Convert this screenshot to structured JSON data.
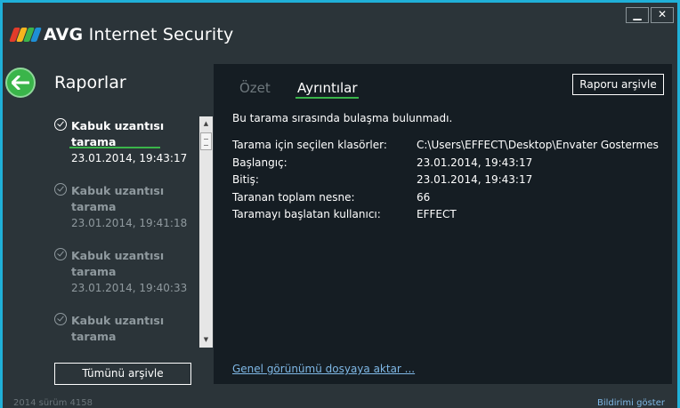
{
  "app": {
    "brand_bold": "AVG",
    "brand_rest": " Internet Security",
    "window_min": "▁",
    "window_close": "✕"
  },
  "sidebar": {
    "title": "Raporlar",
    "reports": [
      {
        "name": "Kabuk uzantısı tarama",
        "date": "23.01.2014, 19:43:17",
        "active": true
      },
      {
        "name": "Kabuk uzantısı tarama",
        "date": "23.01.2014, 19:41:18",
        "active": false
      },
      {
        "name": "Kabuk uzantısı tarama",
        "date": "23.01.2014, 19:40:33",
        "active": false
      },
      {
        "name": "Kabuk uzantısı tarama",
        "date": "",
        "active": false
      }
    ],
    "archive_all_label": "Tümünü arşivle"
  },
  "main": {
    "tabs": [
      {
        "label": "Özet",
        "selected": false
      },
      {
        "label": "Ayrıntılar",
        "selected": true
      }
    ],
    "archive_report_label": "Raporu arşivle",
    "message": "Bu tarama sırasında bulaşma bulunmadı.",
    "details": [
      {
        "key": "Tarama için seçilen klasörler:",
        "value": "C:\\Users\\EFFECT\\Desktop\\Envater Gostermes"
      },
      {
        "key": "Başlangıç:",
        "value": "23.01.2014, 19:43:17"
      },
      {
        "key": "Bitiş:",
        "value": "23.01.2014, 19:43:17"
      },
      {
        "key": "Taranan toplam nesne:",
        "value": "66"
      },
      {
        "key": "Taramayı başlatan kullanıcı:",
        "value": "EFFECT"
      }
    ],
    "export_link": "Genel görünümü dosyaya aktar ..."
  },
  "status": {
    "version": "2014  sürüm 4158",
    "notify_link": "Bildirimi göster"
  },
  "colors": {
    "accent_green": "#3ab54a",
    "frame_blue": "#1fb0d8",
    "link_blue": "#7fb8e6"
  }
}
